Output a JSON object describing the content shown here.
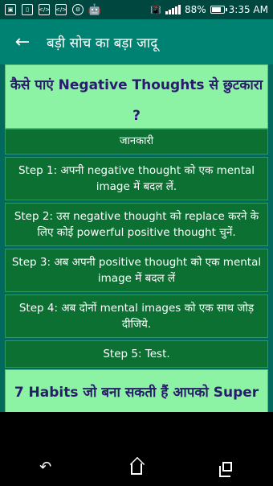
{
  "status_bar": {
    "battery_percent": "88%",
    "time": "3:35 AM",
    "left_icons": [
      "image-icon",
      "tablet-icon",
      "code-icon",
      "code-icon",
      "settings-icon",
      "android-icon"
    ]
  },
  "toolbar": {
    "title": "बड़ी सोच का बड़ा जादू",
    "back_icon": "arrow-back-icon"
  },
  "sections": [
    {
      "heading": "कैसे पाएं Negative Thoughts से छुटकारा ?",
      "label": "जानकारी",
      "steps": [
        "Step 1: अपनी negative thought को एक mental image में बदल लें.",
        "Step 2: उस negative thought को replace करने के लिए कोई powerful positive thought चुनें.",
        "Step 3: अब अपनी positive thought को एक mental image में बदल लें",
        "Step 4: अब दोनों mental images को एक साथ जोड़ दीजिये.",
        "Step 5: Test."
      ]
    },
    {
      "heading": "7 Habits जो बना सकती हैं आपको Super"
    }
  ],
  "nav_bar": {
    "back_icon": "back-nav-icon",
    "home_icon": "home-icon",
    "recents_icon": "recents-icon"
  },
  "colors": {
    "status_bar": "#00483f",
    "toolbar": "#008272",
    "background": "#03685e",
    "card": "#8cf2a4",
    "heading_text": "#2a1c6c",
    "step_bg": "#0d7033"
  }
}
